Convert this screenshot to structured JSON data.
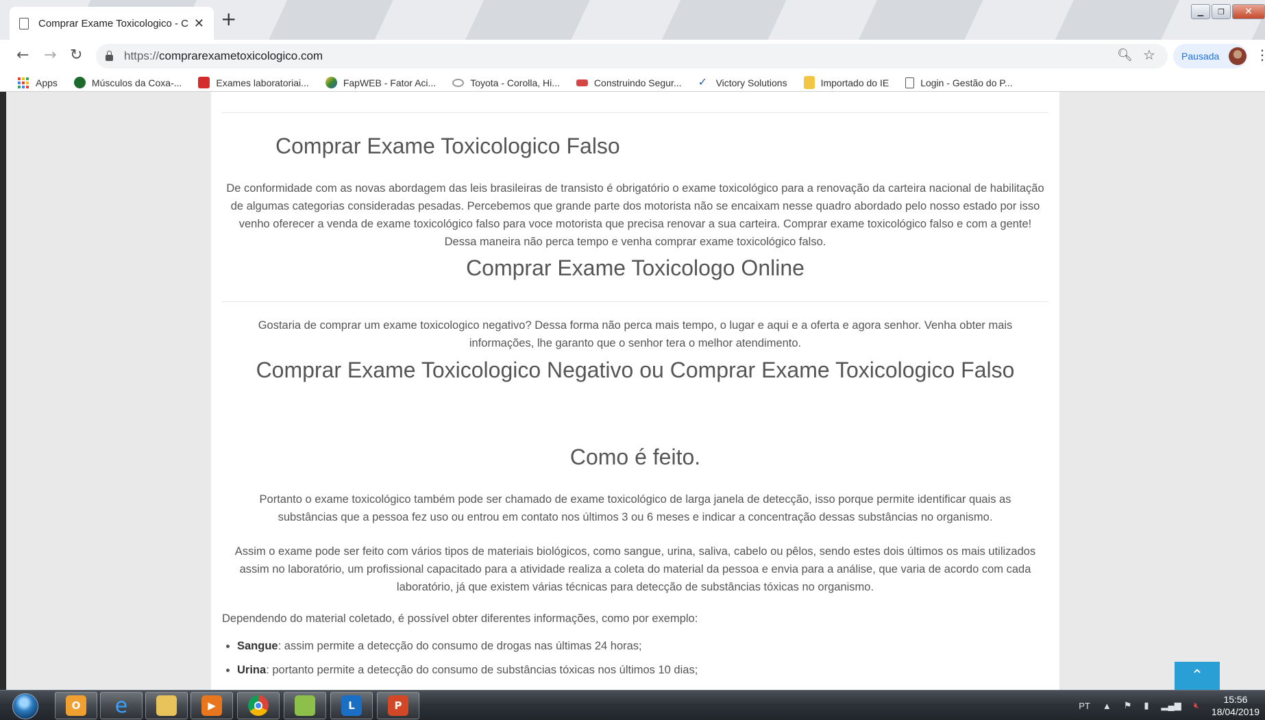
{
  "browser": {
    "tab_title": "Comprar Exame Toxicologico - C",
    "url_protocol": "https://",
    "url_host": "comprarexametoxicologico.com",
    "profile_label": "Pausada"
  },
  "bookmarks": [
    {
      "label": "Apps",
      "color": "#4285f4"
    },
    {
      "label": "Músculos da Coxa-...",
      "color": "#1d6b2c"
    },
    {
      "label": "Exames laboratoriai...",
      "color": "#d62b2b"
    },
    {
      "label": "FapWEB - Fator Aci...",
      "color": "#3c8d2f"
    },
    {
      "label": "Toyota - Corolla, Hi...",
      "color": "#9a9a9a"
    },
    {
      "label": "Construindo Segur...",
      "color": "#d64545"
    },
    {
      "label": "Victory Solutions",
      "color": "#1e5fb5"
    },
    {
      "label": "Importado do IE",
      "color": "#f4c542"
    },
    {
      "label": "Login - Gestão do P...",
      "color": "#ffffff"
    }
  ],
  "article": {
    "h_falso": "Comprar Exame Toxicologico Falso",
    "p_falso": "De conformidade com as novas abordagem das leis brasileiras de transisto é obrigatório o exame toxicológico para a renovação da carteira nacional de habilitação de algumas categorias consideradas pesadas. Percebemos que grande parte dos motorista não se encaixam nesse quadro abordado pelo nosso estado por isso venho oferecer a venda de exame toxicológico falso para voce motorista que precisa renovar a sua carteira. Comprar exame toxicológico falso e com a gente! Dessa maneira não perca tempo e venha comprar exame toxicológico falso.",
    "h_online": "Comprar Exame Toxicologo Online",
    "p_online": "Gostaria de comprar um exame toxicologico negativo? Dessa forma não perca mais tempo, o lugar e aqui e a oferta e agora senhor. Venha obter mais informações, lhe garanto que o senhor tera o melhor atendimento.",
    "h_negativo": "Comprar Exame Toxicologico Negativo ou Comprar Exame Toxicologico Falso",
    "h_como": "Como é feito.",
    "p_como1": "Portanto o exame toxicológico também pode ser chamado de exame toxicológico de larga janela de detecção, isso porque permite identificar quais as substâncias que a pessoa fez uso ou entrou em contato nos últimos 3 ou 6 meses e indicar a concentração dessas substâncias no organismo.",
    "p_como2": "Assim o exame pode ser feito com vários tipos de materiais biológicos, como sangue, urina, saliva, cabelo ou pêlos, sendo estes dois últimos os mais utilizados assim no laboratório, um profissional capacitado para a atividade realiza a coleta do material da pessoa e envia para a análise, que varia de acordo com cada laboratório, já que existem várias técnicas para detecção de substâncias tóxicas no organismo.",
    "p_como3": "Dependendo do material coletado, é possível obter diferentes informações, como por exemplo:",
    "list": [
      {
        "term": "Sangue",
        "text": ": assim permite a detecção do consumo de drogas nas últimas 24 horas;"
      },
      {
        "term": "Urina",
        "text": ": portanto permite a detecção do consumo de substâncias tóxicas nos últimos 10 dias;"
      }
    ]
  },
  "taskbar": {
    "language": "PT",
    "time": "15:56",
    "date": "18/04/2019",
    "accent_color": "#2a9fd6"
  }
}
